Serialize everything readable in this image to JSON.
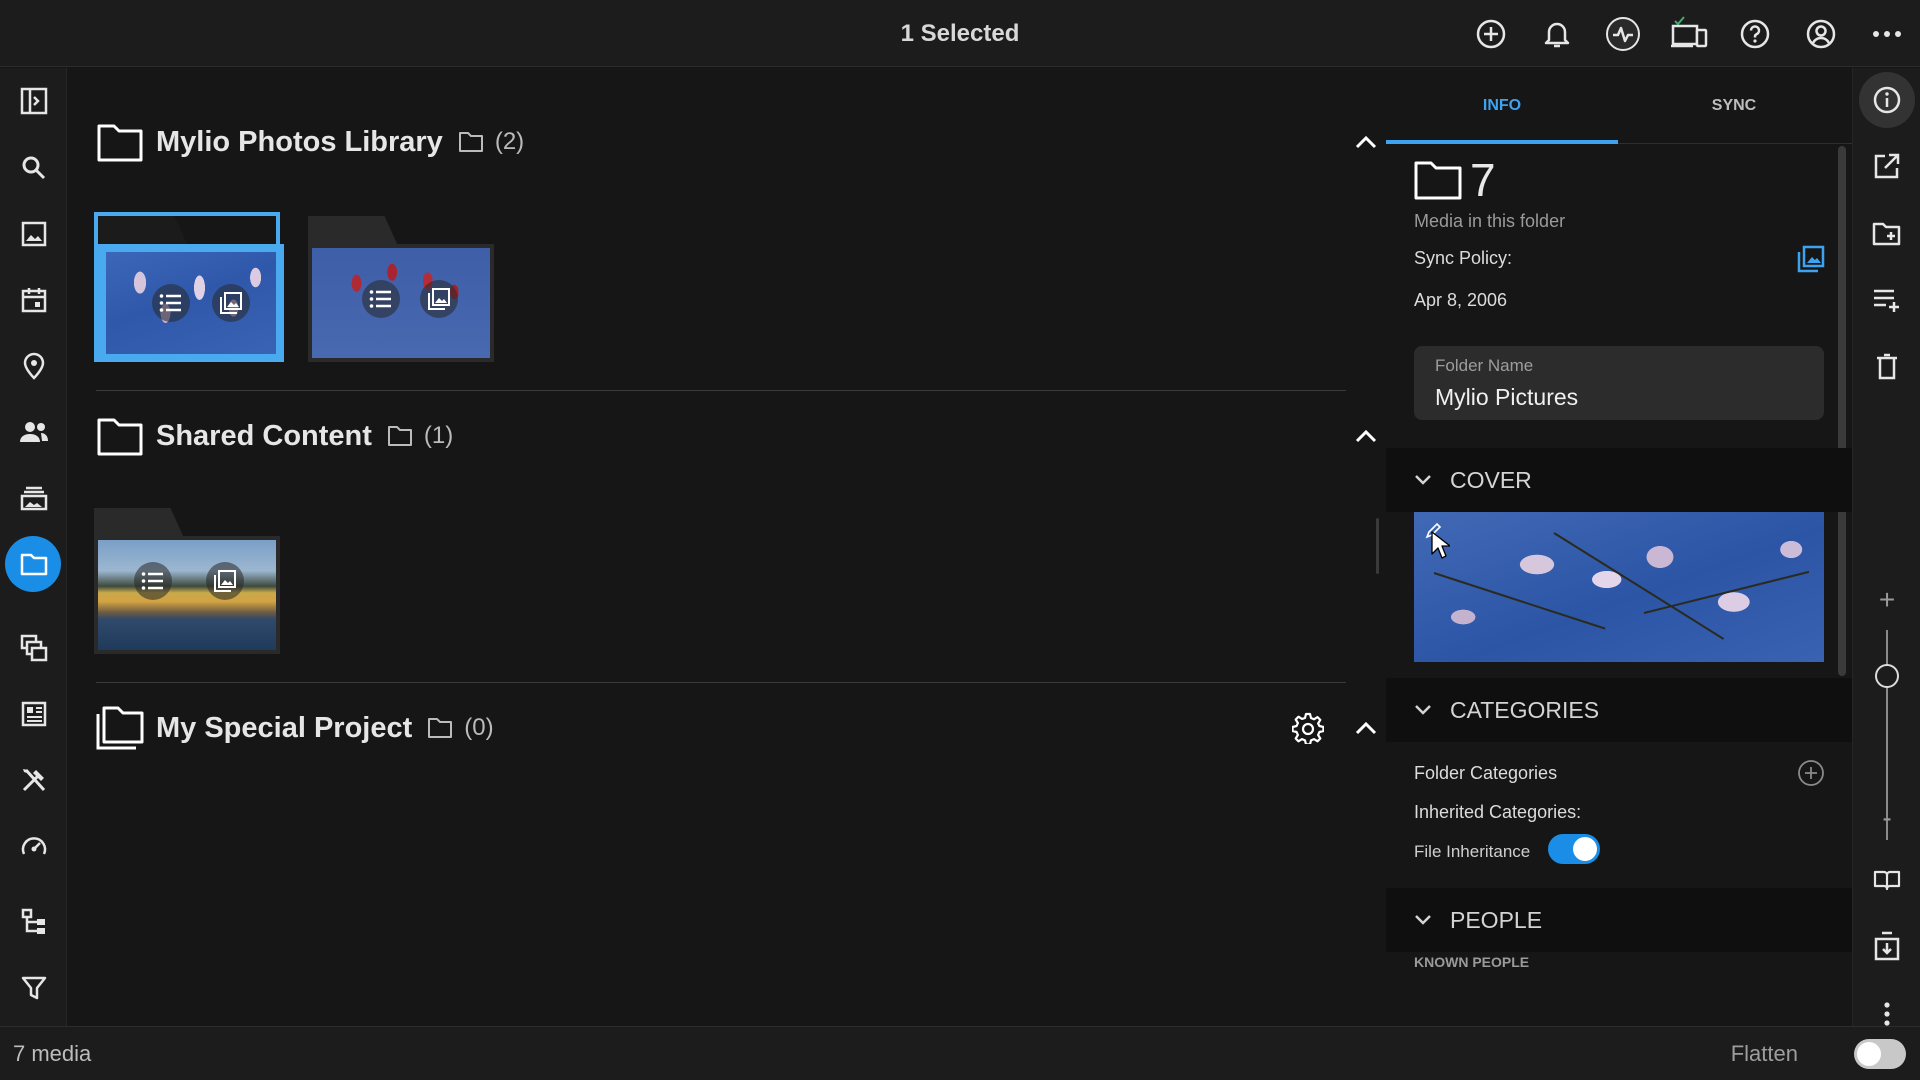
{
  "header": {
    "title": "1 Selected"
  },
  "top_actions": [
    "add-icon",
    "bell-icon",
    "activity-icon",
    "devices-icon",
    "help-icon",
    "account-icon",
    "more-icon"
  ],
  "left_nav": [
    "panel-toggle-icon",
    "search-icon",
    "photos-icon",
    "calendar-icon",
    "map-pin-icon",
    "people-icon",
    "albums-icon",
    "folders-icon",
    "duplicates-icon",
    "dashboard-icon",
    "tools-icon",
    "speed-icon",
    "hierarchy-icon",
    "filter-icon"
  ],
  "sections": [
    {
      "name": "Mylio Photos Library",
      "count": "(2)"
    },
    {
      "name": "Shared Content",
      "count": "(1)"
    },
    {
      "name": "My Special Project",
      "count": "(0)"
    }
  ],
  "panel": {
    "tabs": {
      "info": "INFO",
      "sync": "SYNC"
    },
    "media_count": "7",
    "media_label": "Media in this folder",
    "sync_policy_label": "Sync Policy:",
    "date": "Apr 8, 2006",
    "folder_name_label": "Folder Name",
    "folder_name_value": "Mylio Pictures",
    "cover_header": "COVER",
    "categories_header": "CATEGORIES",
    "folder_categories_label": "Folder Categories",
    "inherited_categories_label": "Inherited Categories:",
    "file_inheritance_label": "File Inheritance",
    "file_inheritance_on": true,
    "people_header": "PEOPLE",
    "known_people_label": "KNOWN PEOPLE"
  },
  "right_rail": [
    "info-icon",
    "open-external-icon",
    "add-folder-icon",
    "add-to-list-icon",
    "trash-icon",
    "zoom-in-icon",
    "zoom-out-icon",
    "book-icon",
    "import-icon",
    "more-vertical-icon"
  ],
  "zoom": {
    "plus": "+",
    "minus": "-"
  },
  "status": {
    "media_count": "7 media",
    "flatten_label": "Flatten",
    "flatten_on": false
  },
  "colors": {
    "accent": "#1a8ee6",
    "tab_active": "#3da3f0",
    "background": "#161616"
  }
}
